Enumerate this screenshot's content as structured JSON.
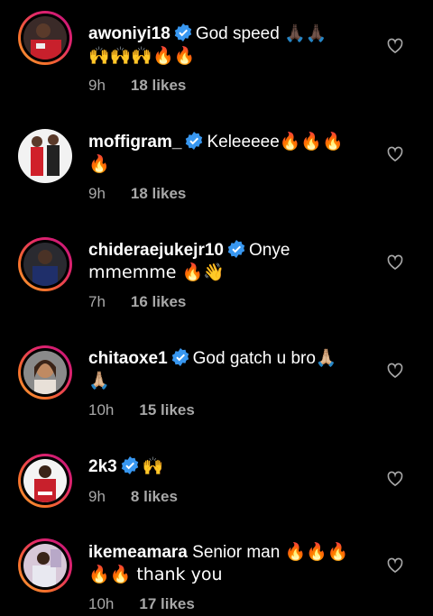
{
  "comments": [
    {
      "username": "awoniyi18",
      "verified": true,
      "text": "God speed 🙏🏿🙏🏿",
      "line2": "🙌🙌🙌🔥🔥",
      "time": "9h",
      "likes": "18 likes"
    },
    {
      "username": "moffigram_",
      "verified": true,
      "text": "Keleeeee🔥🔥🔥",
      "line2": "🔥",
      "time": "9h",
      "likes": "18 likes"
    },
    {
      "username": "chideraejukejr10",
      "verified": true,
      "text": "Onye",
      "line2": "mmemme 🔥👋",
      "time": "7h",
      "likes": "16 likes"
    },
    {
      "username": "chitaoxe1",
      "verified": true,
      "text": "God gatch u bro🙏🏼",
      "line2": "🙏🏼",
      "time": "10h",
      "likes": "15 likes"
    },
    {
      "username": "2k3",
      "verified": true,
      "text": "🙌",
      "line2": "",
      "time": "9h",
      "likes": "8 likes"
    },
    {
      "username": "ikemeamara",
      "verified": false,
      "text": "Senior man 🔥🔥🔥",
      "line2": "🔥🔥 thank you",
      "time": "10h",
      "likes": "17 likes"
    }
  ],
  "colors": {
    "background": "#000000",
    "text": "#ffffff",
    "meta": "#a8a8a8",
    "verified": "#3897f0"
  },
  "icons": {
    "verified": "verified-badge-icon",
    "like": "heart-outline-icon"
  }
}
